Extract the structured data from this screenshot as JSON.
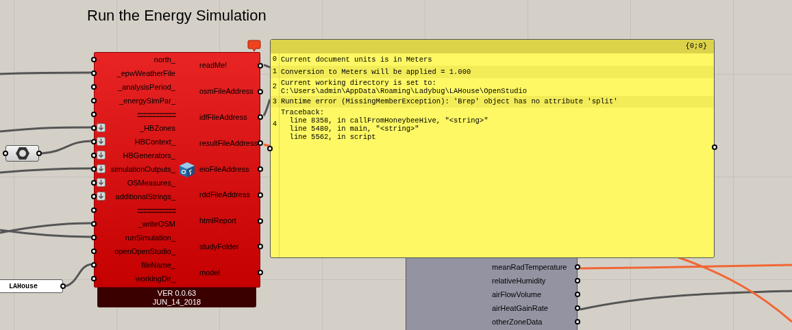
{
  "title": "Run the Energy Simulation",
  "component": {
    "error": true,
    "inputs": [
      {
        "label": "north_",
        "flattened": false
      },
      {
        "label": "_epwWeatherFile",
        "flattened": false
      },
      {
        "label": "_analysisPeriod_",
        "flattened": false
      },
      {
        "label": "_energySimPar_",
        "flattened": false
      },
      {
        "label": "::::::::::::::::::::::::::",
        "flattened": false,
        "kind": "separator"
      },
      {
        "label": "_HBZones",
        "flattened": true
      },
      {
        "label": "HBContext_",
        "flattened": true
      },
      {
        "label": "HBGenerators_",
        "flattened": true
      },
      {
        "label": "simulationOutputs_",
        "flattened": true
      },
      {
        "label": "OSMeasures_",
        "flattened": true
      },
      {
        "label": "additionalStrings_",
        "flattened": true
      },
      {
        "label": "::::::::::::::::::::::::::",
        "flattened": false,
        "kind": "separator"
      },
      {
        "label": "_writeOSM",
        "flattened": false
      },
      {
        "label": "runSimulation_",
        "flattened": false
      },
      {
        "label": "openOpenStudio_",
        "flattened": false
      },
      {
        "label": "fileName_",
        "flattened": false
      },
      {
        "label": "workingDir_",
        "flattened": false
      }
    ],
    "outputs": [
      "readMe!",
      "osmFileAddress",
      "idfFileAddress",
      "resultFileAddress",
      "eioFileAddress",
      "rddFileAddress",
      "htmlReport",
      "studyFolder",
      "model"
    ],
    "version": "VER 0.0.63",
    "date": "JUN_14_2018"
  },
  "panel": {
    "path": "{0;0}",
    "entries": [
      {
        "index": "0",
        "lines": [
          "Current document units is in Meters"
        ]
      },
      {
        "index": "1",
        "lines": [
          "Conversion to Meters will be applied = 1.000"
        ]
      },
      {
        "index": "2",
        "lines": [
          "Current working directory is set to:",
          "C:\\Users\\admin\\AppData\\Roaming\\Ladybug\\LAHouse\\OpenStudio"
        ]
      },
      {
        "index": "3",
        "lines": [
          "Runtime error (MissingMemberException): 'Brep' object has no attribute 'split'"
        ]
      },
      {
        "index": "4",
        "lines": [
          "Traceback:",
          "  line 8358, in callFromHoneybeeHive, \"<string>\"",
          "  line 5480, in main, \"<string>\"",
          "  line 5562, in script"
        ]
      }
    ]
  },
  "text_panel": {
    "value": "LAHouse"
  },
  "results_component": {
    "outputs": [
      "meanRadTemperature",
      "relativeHumidity",
      "airFlowVolume",
      "airHeatGainRate",
      "otherZoneData"
    ]
  }
}
